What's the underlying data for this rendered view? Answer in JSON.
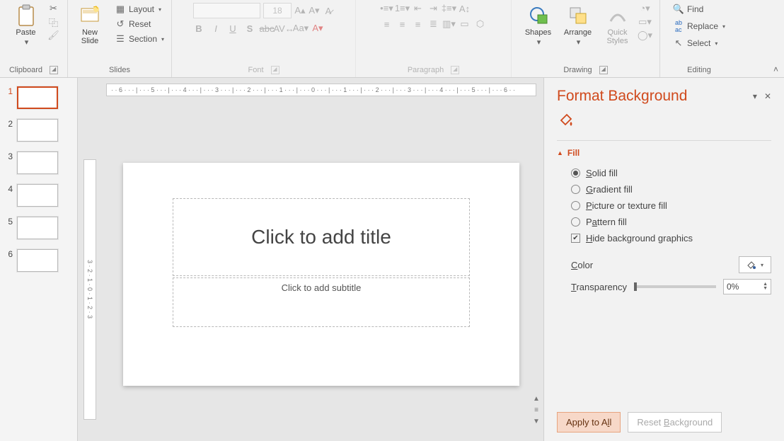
{
  "ribbon": {
    "clipboard": {
      "label": "Clipboard",
      "paste": "Paste"
    },
    "slides": {
      "label": "Slides",
      "newslide": "New\nSlide",
      "layout": "Layout",
      "reset": "Reset",
      "section": "Section"
    },
    "font": {
      "label": "Font",
      "size": "18"
    },
    "paragraph": {
      "label": "Paragraph"
    },
    "drawing": {
      "label": "Drawing",
      "shapes": "Shapes",
      "arrange": "Arrange",
      "quick": "Quick\nStyles"
    },
    "editing": {
      "label": "Editing",
      "find": "Find",
      "replace": "Replace",
      "select": "Select"
    }
  },
  "ruler_h": "· · 6 · · · | · · · 5 · · · | · · · 4 · · · | · · · 3 · · · | · · · 2 · · · | · · · 1 · · · | · · · 0 · · · | · · · 1 · · · | · · · 2 · · · | · · · 3 · · · | · · · 4 · · · | · · · 5 · · · | · · · 6 · ·",
  "ruler_v": "3 · 2 · 1 · 0 · 1 · 2 · 3",
  "thumbnails": [
    {
      "n": "1",
      "active": true
    },
    {
      "n": "2",
      "active": false
    },
    {
      "n": "3",
      "active": false
    },
    {
      "n": "4",
      "active": false
    },
    {
      "n": "5",
      "active": false
    },
    {
      "n": "6",
      "active": false
    }
  ],
  "slide": {
    "title_ph": "Click to add title",
    "sub_ph": "Click to add subtitle"
  },
  "pane": {
    "title": "Format Background",
    "section": "Fill",
    "opts": {
      "solid": "Solid fill",
      "gradient": "Gradient fill",
      "picture": "Picture or texture fill",
      "pattern": "Pattern fill"
    },
    "hide": "Hide background graphics",
    "color": "Color",
    "transparency": "Transparency",
    "trans_val": "0%",
    "apply": "Apply to All",
    "reset": "Reset Background"
  }
}
